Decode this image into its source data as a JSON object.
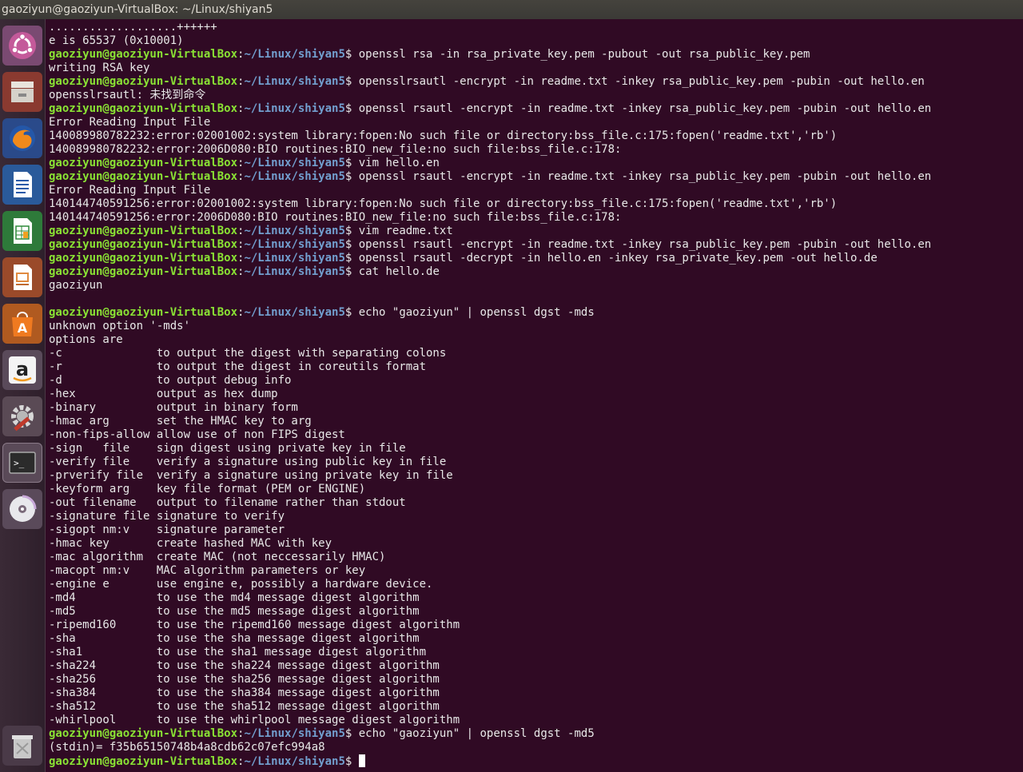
{
  "window": {
    "title": "gaoziyun@gaoziyun-VirtualBox: ~/Linux/shiyan5"
  },
  "launcher": [
    {
      "name": "ubuntu-dash-icon"
    },
    {
      "name": "files-icon"
    },
    {
      "name": "firefox-icon"
    },
    {
      "name": "writer-icon"
    },
    {
      "name": "calc-icon"
    },
    {
      "name": "impress-icon"
    },
    {
      "name": "software-center-icon"
    },
    {
      "name": "amazon-icon"
    },
    {
      "name": "settings-icon"
    },
    {
      "name": "terminal-icon"
    },
    {
      "name": "dvd-icon"
    },
    {
      "name": "trash-icon"
    }
  ],
  "prompt": {
    "user": "gaoziyun@gaoziyun-VirtualBox",
    "path": "~/Linux/shiyan5"
  },
  "lines": [
    {
      "type": "out",
      "text": "...................++++++"
    },
    {
      "type": "out",
      "text": "e is 65537 (0x10001)"
    },
    {
      "type": "cmd",
      "text": "openssl rsa -in rsa_private_key.pem -pubout -out rsa_public_key.pem"
    },
    {
      "type": "out",
      "text": "writing RSA key"
    },
    {
      "type": "cmd",
      "text": "opensslrsautl -encrypt -in readme.txt -inkey rsa_public_key.pem -pubin -out hello.en"
    },
    {
      "type": "out",
      "text": "opensslrsautl: 未找到命令"
    },
    {
      "type": "cmd",
      "text": "openssl rsautl -encrypt -in readme.txt -inkey rsa_public_key.pem -pubin -out hello.en"
    },
    {
      "type": "out",
      "text": "Error Reading Input File"
    },
    {
      "type": "out",
      "text": "140089980782232:error:02001002:system library:fopen:No such file or directory:bss_file.c:175:fopen('readme.txt','rb')"
    },
    {
      "type": "out",
      "text": "140089980782232:error:2006D080:BIO routines:BIO_new_file:no such file:bss_file.c:178:"
    },
    {
      "type": "cmd",
      "text": "vim hello.en"
    },
    {
      "type": "cmd",
      "text": "openssl rsautl -encrypt -in readme.txt -inkey rsa_public_key.pem -pubin -out hello.en"
    },
    {
      "type": "out",
      "text": "Error Reading Input File"
    },
    {
      "type": "out",
      "text": "140144740591256:error:02001002:system library:fopen:No such file or directory:bss_file.c:175:fopen('readme.txt','rb')"
    },
    {
      "type": "out",
      "text": "140144740591256:error:2006D080:BIO routines:BIO_new_file:no such file:bss_file.c:178:"
    },
    {
      "type": "cmd",
      "text": "vim readme.txt"
    },
    {
      "type": "cmd",
      "text": "openssl rsautl -encrypt -in readme.txt -inkey rsa_public_key.pem -pubin -out hello.en"
    },
    {
      "type": "cmd",
      "text": "openssl rsautl -decrypt -in hello.en -inkey rsa_private_key.pem -out hello.de"
    },
    {
      "type": "cmd",
      "text": "cat hello.de"
    },
    {
      "type": "out",
      "text": "gaoziyun"
    },
    {
      "type": "out",
      "text": ""
    },
    {
      "type": "cmd",
      "text": "echo \"gaoziyun\" | openssl dgst -mds"
    },
    {
      "type": "out",
      "text": "unknown option '-mds'"
    },
    {
      "type": "out",
      "text": "options are"
    },
    {
      "type": "out",
      "text": "-c              to output the digest with separating colons"
    },
    {
      "type": "out",
      "text": "-r              to output the digest in coreutils format"
    },
    {
      "type": "out",
      "text": "-d              to output debug info"
    },
    {
      "type": "out",
      "text": "-hex            output as hex dump"
    },
    {
      "type": "out",
      "text": "-binary         output in binary form"
    },
    {
      "type": "out",
      "text": "-hmac arg       set the HMAC key to arg"
    },
    {
      "type": "out",
      "text": "-non-fips-allow allow use of non FIPS digest"
    },
    {
      "type": "out",
      "text": "-sign   file    sign digest using private key in file"
    },
    {
      "type": "out",
      "text": "-verify file    verify a signature using public key in file"
    },
    {
      "type": "out",
      "text": "-prverify file  verify a signature using private key in file"
    },
    {
      "type": "out",
      "text": "-keyform arg    key file format (PEM or ENGINE)"
    },
    {
      "type": "out",
      "text": "-out filename   output to filename rather than stdout"
    },
    {
      "type": "out",
      "text": "-signature file signature to verify"
    },
    {
      "type": "out",
      "text": "-sigopt nm:v    signature parameter"
    },
    {
      "type": "out",
      "text": "-hmac key       create hashed MAC with key"
    },
    {
      "type": "out",
      "text": "-mac algorithm  create MAC (not neccessarily HMAC)"
    },
    {
      "type": "out",
      "text": "-macopt nm:v    MAC algorithm parameters or key"
    },
    {
      "type": "out",
      "text": "-engine e       use engine e, possibly a hardware device."
    },
    {
      "type": "out",
      "text": "-md4            to use the md4 message digest algorithm"
    },
    {
      "type": "out",
      "text": "-md5            to use the md5 message digest algorithm"
    },
    {
      "type": "out",
      "text": "-ripemd160      to use the ripemd160 message digest algorithm"
    },
    {
      "type": "out",
      "text": "-sha            to use the sha message digest algorithm"
    },
    {
      "type": "out",
      "text": "-sha1           to use the sha1 message digest algorithm"
    },
    {
      "type": "out",
      "text": "-sha224         to use the sha224 message digest algorithm"
    },
    {
      "type": "out",
      "text": "-sha256         to use the sha256 message digest algorithm"
    },
    {
      "type": "out",
      "text": "-sha384         to use the sha384 message digest algorithm"
    },
    {
      "type": "out",
      "text": "-sha512         to use the sha512 message digest algorithm"
    },
    {
      "type": "out",
      "text": "-whirlpool      to use the whirlpool message digest algorithm"
    },
    {
      "type": "cmd",
      "text": "echo \"gaoziyun\" | openssl dgst -md5"
    },
    {
      "type": "out",
      "text": "(stdin)= f35b65150748b4a8cdb62c07efc994a8"
    },
    {
      "type": "cmd",
      "text": "",
      "cursor": true
    }
  ],
  "colors": {
    "background": "#300a24",
    "user": "#8ae234",
    "path": "#729fcf",
    "text": "#e8e8e8"
  }
}
